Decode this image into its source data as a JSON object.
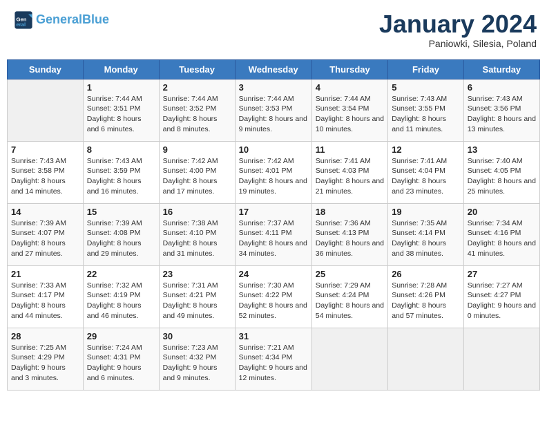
{
  "header": {
    "logo_general": "General",
    "logo_blue": "Blue",
    "month_title": "January 2024",
    "subtitle": "Paniowki, Silesia, Poland"
  },
  "weekdays": [
    "Sunday",
    "Monday",
    "Tuesday",
    "Wednesday",
    "Thursday",
    "Friday",
    "Saturday"
  ],
  "weeks": [
    [
      {
        "day": "",
        "empty": true
      },
      {
        "day": "1",
        "sunrise": "7:44 AM",
        "sunset": "3:51 PM",
        "daylight": "8 hours and 6 minutes."
      },
      {
        "day": "2",
        "sunrise": "7:44 AM",
        "sunset": "3:52 PM",
        "daylight": "8 hours and 8 minutes."
      },
      {
        "day": "3",
        "sunrise": "7:44 AM",
        "sunset": "3:53 PM",
        "daylight": "8 hours and 9 minutes."
      },
      {
        "day": "4",
        "sunrise": "7:44 AM",
        "sunset": "3:54 PM",
        "daylight": "8 hours and 10 minutes."
      },
      {
        "day": "5",
        "sunrise": "7:43 AM",
        "sunset": "3:55 PM",
        "daylight": "8 hours and 11 minutes."
      },
      {
        "day": "6",
        "sunrise": "7:43 AM",
        "sunset": "3:56 PM",
        "daylight": "8 hours and 13 minutes."
      }
    ],
    [
      {
        "day": "7",
        "sunrise": "7:43 AM",
        "sunset": "3:58 PM",
        "daylight": "8 hours and 14 minutes."
      },
      {
        "day": "8",
        "sunrise": "7:43 AM",
        "sunset": "3:59 PM",
        "daylight": "8 hours and 16 minutes."
      },
      {
        "day": "9",
        "sunrise": "7:42 AM",
        "sunset": "4:00 PM",
        "daylight": "8 hours and 17 minutes."
      },
      {
        "day": "10",
        "sunrise": "7:42 AM",
        "sunset": "4:01 PM",
        "daylight": "8 hours and 19 minutes."
      },
      {
        "day": "11",
        "sunrise": "7:41 AM",
        "sunset": "4:03 PM",
        "daylight": "8 hours and 21 minutes."
      },
      {
        "day": "12",
        "sunrise": "7:41 AM",
        "sunset": "4:04 PM",
        "daylight": "8 hours and 23 minutes."
      },
      {
        "day": "13",
        "sunrise": "7:40 AM",
        "sunset": "4:05 PM",
        "daylight": "8 hours and 25 minutes."
      }
    ],
    [
      {
        "day": "14",
        "sunrise": "7:39 AM",
        "sunset": "4:07 PM",
        "daylight": "8 hours and 27 minutes."
      },
      {
        "day": "15",
        "sunrise": "7:39 AM",
        "sunset": "4:08 PM",
        "daylight": "8 hours and 29 minutes."
      },
      {
        "day": "16",
        "sunrise": "7:38 AM",
        "sunset": "4:10 PM",
        "daylight": "8 hours and 31 minutes."
      },
      {
        "day": "17",
        "sunrise": "7:37 AM",
        "sunset": "4:11 PM",
        "daylight": "8 hours and 34 minutes."
      },
      {
        "day": "18",
        "sunrise": "7:36 AM",
        "sunset": "4:13 PM",
        "daylight": "8 hours and 36 minutes."
      },
      {
        "day": "19",
        "sunrise": "7:35 AM",
        "sunset": "4:14 PM",
        "daylight": "8 hours and 38 minutes."
      },
      {
        "day": "20",
        "sunrise": "7:34 AM",
        "sunset": "4:16 PM",
        "daylight": "8 hours and 41 minutes."
      }
    ],
    [
      {
        "day": "21",
        "sunrise": "7:33 AM",
        "sunset": "4:17 PM",
        "daylight": "8 hours and 44 minutes."
      },
      {
        "day": "22",
        "sunrise": "7:32 AM",
        "sunset": "4:19 PM",
        "daylight": "8 hours and 46 minutes."
      },
      {
        "day": "23",
        "sunrise": "7:31 AM",
        "sunset": "4:21 PM",
        "daylight": "8 hours and 49 minutes."
      },
      {
        "day": "24",
        "sunrise": "7:30 AM",
        "sunset": "4:22 PM",
        "daylight": "8 hours and 52 minutes."
      },
      {
        "day": "25",
        "sunrise": "7:29 AM",
        "sunset": "4:24 PM",
        "daylight": "8 hours and 54 minutes."
      },
      {
        "day": "26",
        "sunrise": "7:28 AM",
        "sunset": "4:26 PM",
        "daylight": "8 hours and 57 minutes."
      },
      {
        "day": "27",
        "sunrise": "7:27 AM",
        "sunset": "4:27 PM",
        "daylight": "9 hours and 0 minutes."
      }
    ],
    [
      {
        "day": "28",
        "sunrise": "7:25 AM",
        "sunset": "4:29 PM",
        "daylight": "9 hours and 3 minutes."
      },
      {
        "day": "29",
        "sunrise": "7:24 AM",
        "sunset": "4:31 PM",
        "daylight": "9 hours and 6 minutes."
      },
      {
        "day": "30",
        "sunrise": "7:23 AM",
        "sunset": "4:32 PM",
        "daylight": "9 hours and 9 minutes."
      },
      {
        "day": "31",
        "sunrise": "7:21 AM",
        "sunset": "4:34 PM",
        "daylight": "9 hours and 12 minutes."
      },
      {
        "day": "",
        "empty": true
      },
      {
        "day": "",
        "empty": true
      },
      {
        "day": "",
        "empty": true
      }
    ]
  ]
}
